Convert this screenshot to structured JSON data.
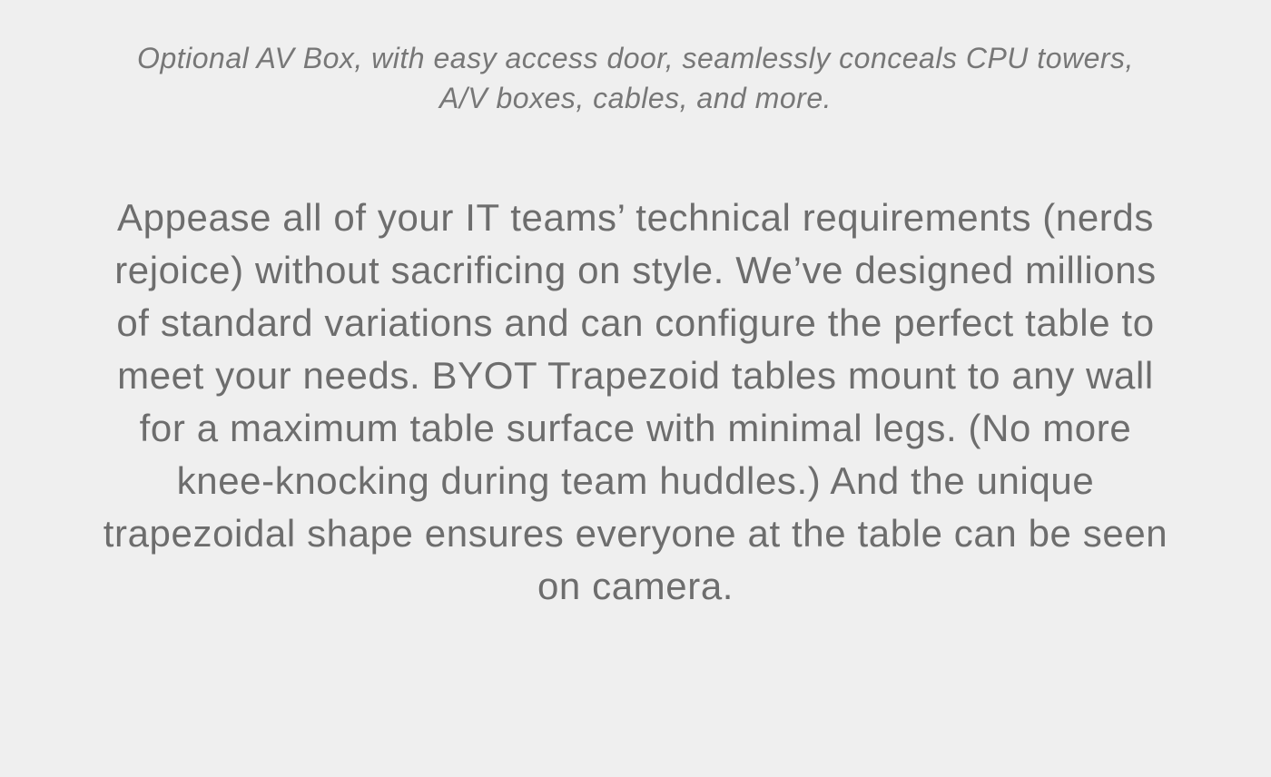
{
  "caption": "Optional AV Box, with easy access door, seamlessly conceals CPU towers, A/V boxes, cables, and more.",
  "body": "Appease all of your IT teams’ technical requirements (nerds rejoice) without sacrificing on style. We’ve designed millions of standard variations and can configure the perfect table to meet your needs. BYOT Trapezoid tables mount to any wall for a maximum table surface with minimal legs. (No more knee-knocking during team huddles.) And the unique trapezoidal shape ensures everyone at the table can be seen on camera."
}
